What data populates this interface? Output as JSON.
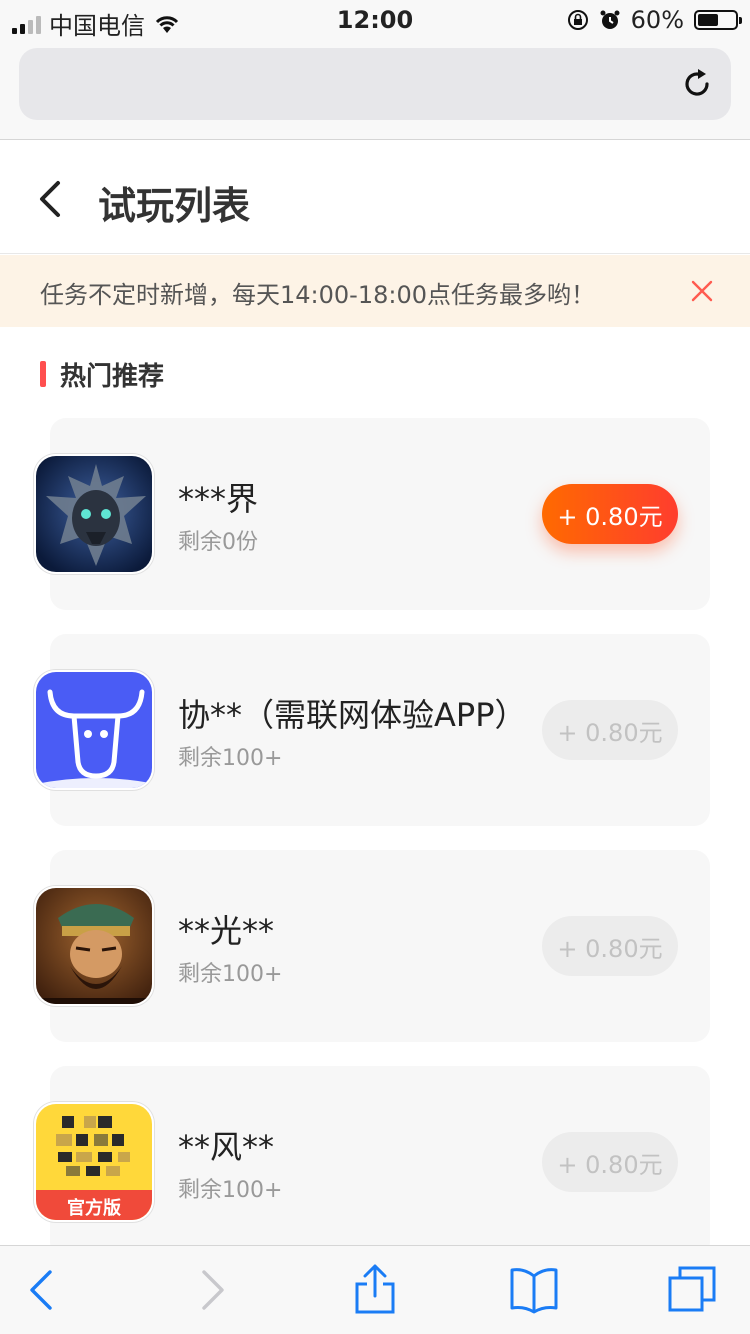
{
  "status_bar": {
    "carrier": "中国电信",
    "time": "12:00",
    "battery_text": "60%",
    "battery_level": 0.6
  },
  "browser": {
    "url_text": "",
    "reload_icon": "reload-icon"
  },
  "header": {
    "back_icon": "chevron-left-icon",
    "title": "试玩列表"
  },
  "notice": {
    "text": "任务不定时新增，每天14:00-18:00点任务最多哟！",
    "close_icon": "close-icon",
    "colors": {
      "background": "#fdf3e6",
      "close": "#ff5a4f"
    }
  },
  "section": {
    "title": "热门推荐",
    "accent": "#ff4f4f"
  },
  "tasks": [
    {
      "name": "***界",
      "remaining": "剩余0份",
      "reward": "+ 0.80元",
      "active": true,
      "icon": "dark-knight-game-icon"
    },
    {
      "name": "协**（需联网体验APP）",
      "remaining": "剩余100+",
      "reward": "+ 0.80元",
      "active": false,
      "icon": "bull-head-app-icon"
    },
    {
      "name": "**光**",
      "remaining": "剩余100+",
      "reward": "+ 0.80元",
      "active": false,
      "icon": "warrior-game-icon"
    },
    {
      "name": "**风**",
      "remaining": "剩余100+",
      "reward": "+ 0.80元",
      "active": false,
      "icon": "yellow-app-icon",
      "icon_badge": "官方版"
    }
  ],
  "toolbar": {
    "items": [
      "back-icon",
      "forward-icon",
      "share-icon",
      "bookmarks-icon",
      "tabs-icon"
    ]
  }
}
